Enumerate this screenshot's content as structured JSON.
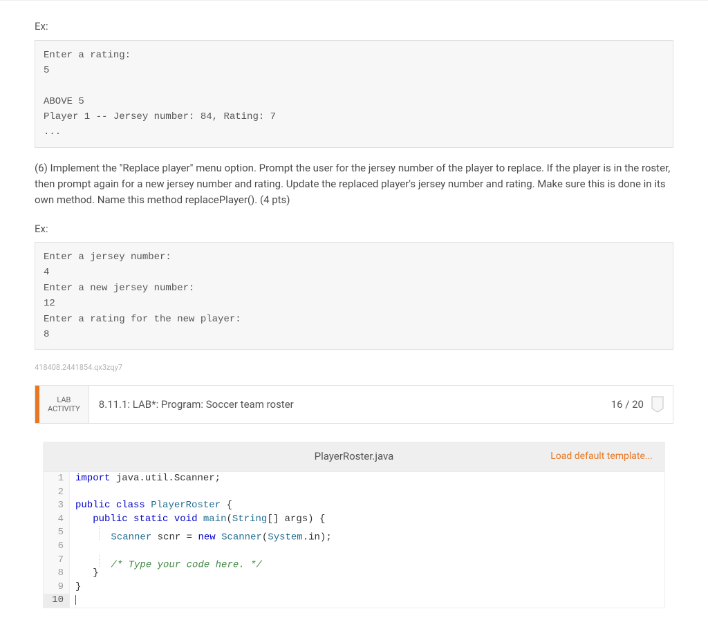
{
  "ex_label": "Ex:",
  "code_block_1": "Enter a rating:\n5\n\nABOVE 5\nPlayer 1 -- Jersey number: 84, Rating: 7\n...",
  "paragraph_6": "(6) Implement the \"Replace player\" menu option. Prompt the user for the jersey number of the player to replace. If the player is in the roster, then prompt again for a new jersey number and rating. Update the replaced player's jersey number and rating. Make sure this is done in its own method. Name this method replacePlayer(). (4 pts)",
  "code_block_2": "Enter a jersey number:\n4\nEnter a new jersey number:\n12\nEnter a rating for the new player:\n8",
  "hash": "418408.2441854.qx3zqy7",
  "activity": {
    "label_line1": "LAB",
    "label_line2": "ACTIVITY",
    "title": "8.11.1: LAB*: Program: Soccer team roster",
    "score": "16 / 20"
  },
  "editor": {
    "filename": "PlayerRoster.java",
    "load_template": "Load default template...",
    "lines": {
      "l1": {
        "kw": "import",
        "rest": " java.util.Scanner;"
      },
      "l3": {
        "kw1": "public",
        "kw2": "class",
        "name": "PlayerRoster",
        "brace": " {"
      },
      "l4": {
        "kw1": "public",
        "kw2": "static",
        "kw3": "void",
        "name": "main",
        "argstype": "String",
        "argsrest": "[] args) {"
      },
      "l5": {
        "type1": "Scanner",
        "var": " scnr = ",
        "kw": "new",
        "type2": " Scanner",
        "paren": "(",
        "sys": "System",
        "rest": ".in);"
      },
      "l7": {
        "comment": "/* Type your code here. */"
      },
      "l8": {
        "brace": "}"
      },
      "l9": {
        "brace": "}"
      }
    }
  }
}
